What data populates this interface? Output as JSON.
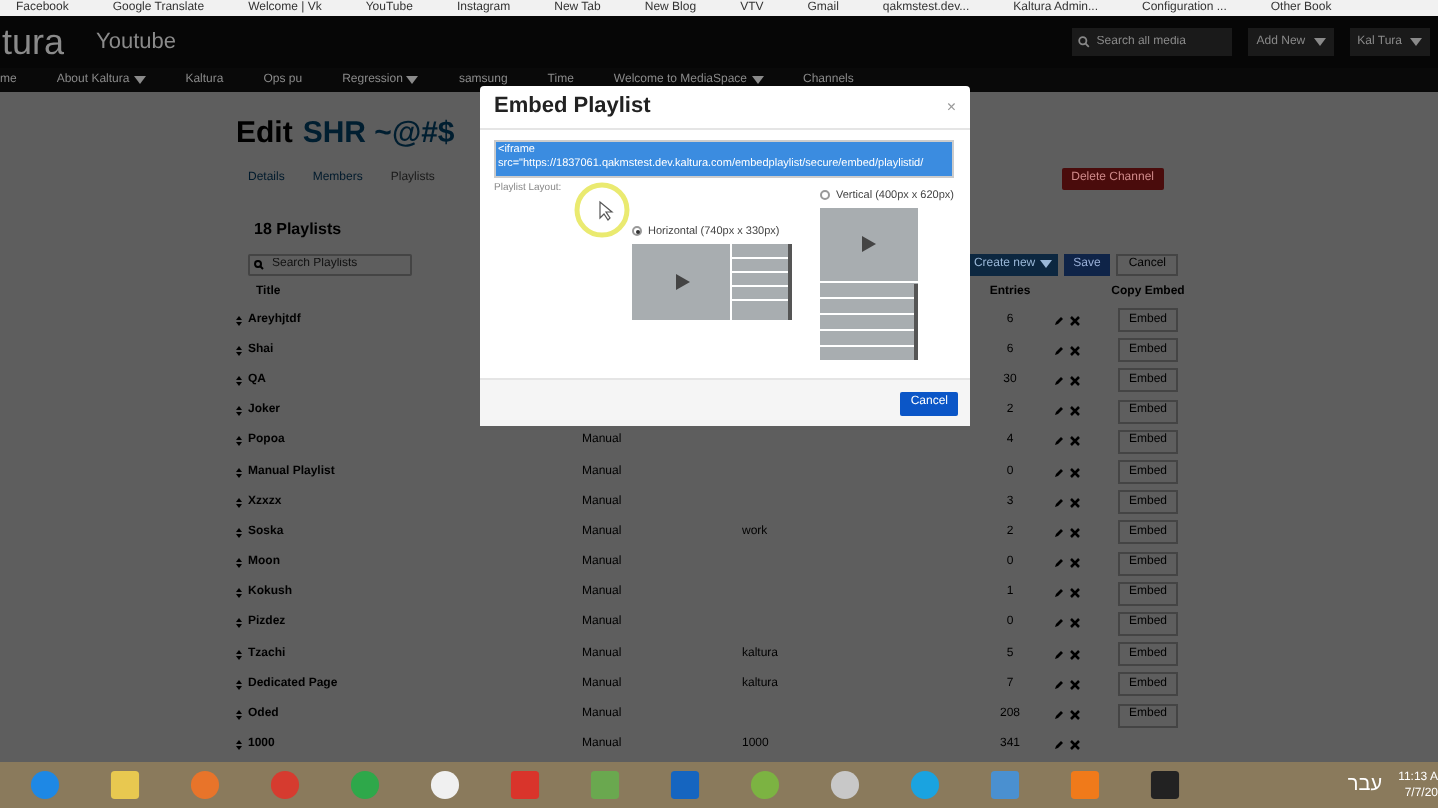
{
  "bookmarks": [
    "Facebook",
    "Google Translate",
    "Welcome | Vk",
    "YouTube",
    "Instagram",
    "New Tab",
    "New Blog",
    "VTV",
    "Gmail",
    "qakmstest.dev...",
    "Kaltura Admin...",
    "Configuration ...",
    "Other Book"
  ],
  "header": {
    "logo": "tura",
    "site": "Youtube",
    "search": {
      "placeholder": "Search all media"
    },
    "add_new": "Add New",
    "user": "Kal Tura"
  },
  "nav": [
    {
      "label": "me",
      "dropdown": false
    },
    {
      "label": "About Kaltura",
      "dropdown": true
    },
    {
      "label": "Kaltura",
      "dropdown": false
    },
    {
      "label": "Ops pu",
      "dropdown": false
    },
    {
      "label": "Regression",
      "dropdown": true
    },
    {
      "label": "samsung",
      "dropdown": false
    },
    {
      "label": "Time",
      "dropdown": false
    },
    {
      "label": "Welcome to MediaSpace",
      "dropdown": true
    },
    {
      "label": "Channels",
      "dropdown": false
    }
  ],
  "page": {
    "title_prefix": "Edit",
    "title_name": "SHR ~@#$",
    "tabs": [
      {
        "label": "Details",
        "selected": false
      },
      {
        "label": "Members",
        "selected": false
      },
      {
        "label": "Playlists",
        "selected": true
      }
    ],
    "delete_button": "Delete Channel",
    "count": "18 Playlists",
    "search": {
      "placeholder": "Search Playlists"
    },
    "create_button": "Create new",
    "save_button": "Save",
    "cancel_button": "Cancel"
  },
  "table": {
    "columns": [
      "Title",
      "Entries",
      "Copy Embed"
    ],
    "rows": [
      {
        "title": "Areyhjtdf",
        "entries": "6",
        "embed": "Embed"
      },
      {
        "title": "Shai",
        "entries": "6",
        "embed": "Embed"
      },
      {
        "title": "QA",
        "entries": "30",
        "embed": "Embed"
      },
      {
        "title": "Joker",
        "entries": "2",
        "embed": "Embed"
      },
      {
        "title": "Popoa",
        "type": "Manual",
        "entries": "4",
        "embed": "Embed"
      },
      {
        "title": "Manual Playlist",
        "type": "Manual",
        "entries": "0",
        "embed": "Embed"
      },
      {
        "title": "Xzxzx",
        "type": "Manual",
        "entries": "3",
        "embed": "Embed"
      },
      {
        "title": "Soska",
        "type": "Manual",
        "tags": "work",
        "entries": "2",
        "embed": "Embed"
      },
      {
        "title": "Moon",
        "type": "Manual",
        "entries": "0",
        "embed": "Embed"
      },
      {
        "title": "Kokush",
        "type": "Manual",
        "entries": "1",
        "embed": "Embed"
      },
      {
        "title": "Pizdez",
        "type": "Manual",
        "entries": "0",
        "embed": "Embed"
      },
      {
        "title": "Tzachi",
        "type": "Manual",
        "tags": "kaltura",
        "entries": "5",
        "embed": "Embed"
      },
      {
        "title": "Dedicated Page",
        "type": "Manual",
        "tags": "kaltura",
        "entries": "7",
        "embed": "Embed"
      },
      {
        "title": "Oded",
        "type": "Manual",
        "entries": "208",
        "embed": "Embed"
      },
      {
        "title": "1000",
        "type": "Manual",
        "tags": "1000",
        "entries": "341"
      }
    ]
  },
  "modal": {
    "title": "Embed Playlist",
    "close": "×",
    "code": "<iframe\nsrc=\"https://1837061.qakmstest.dev.kaltura.com/embedplaylist/secure/embed/playlistid/",
    "layout_label": "Playlist Layout:",
    "layouts": [
      {
        "kind": "horizontal",
        "label": "Horizontal (740px x 330px)",
        "selected": true
      },
      {
        "kind": "vertical",
        "label": "Vertical (400px x 620px)",
        "selected": false
      }
    ],
    "cancel": "Cancel"
  },
  "taskbar": {
    "language": "עבר",
    "time": "11:13 A",
    "date": "7/7/20"
  }
}
